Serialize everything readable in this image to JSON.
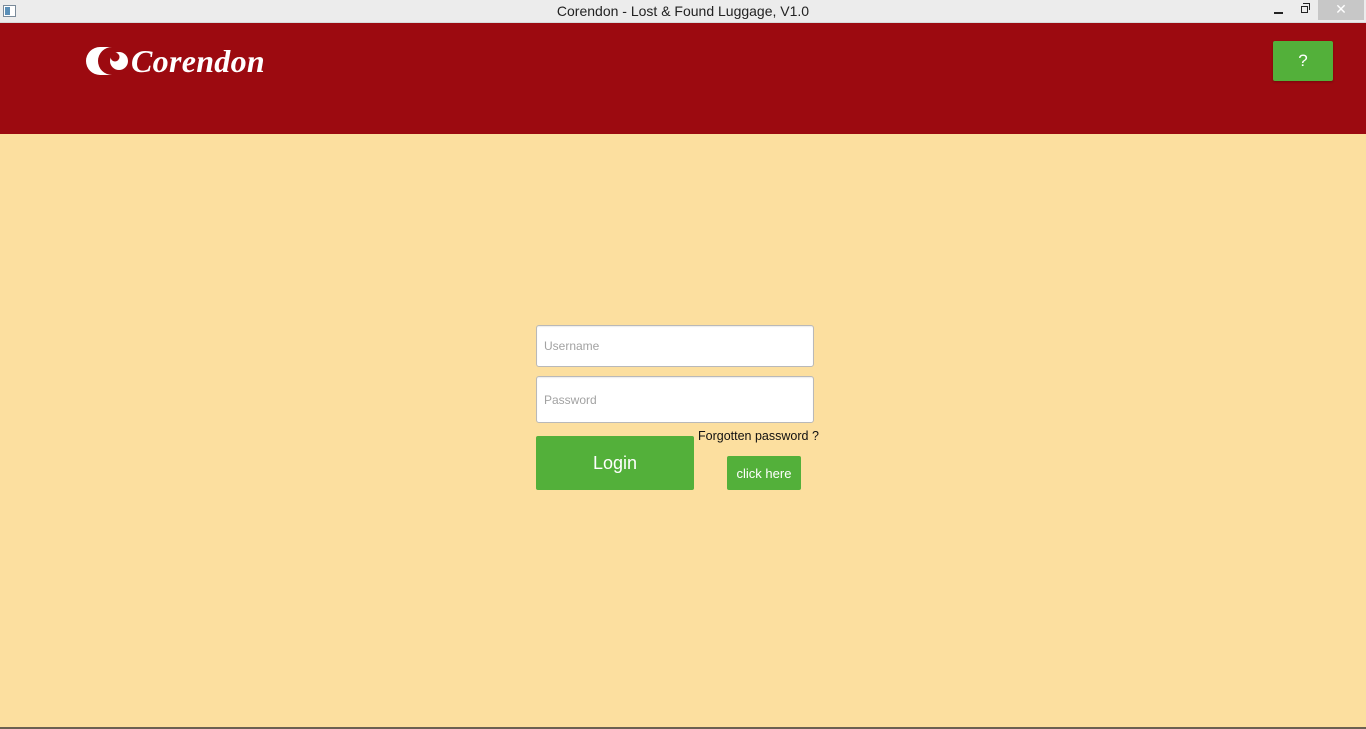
{
  "window": {
    "title": "Corendon - Lost & Found Luggage, V1.0",
    "minimize_icon": "minimize-icon",
    "maximize_icon": "restore-icon",
    "close_icon": "close-icon"
  },
  "header": {
    "brand": "Corendon",
    "logo_icon": "corendon-logo-mark",
    "help_label": "?",
    "background_color": "#9c0a10"
  },
  "login": {
    "username_placeholder": "Username",
    "username_value": "",
    "password_placeholder": "Password",
    "password_value": "",
    "login_label": "Login",
    "forgot_text": "Forgotten password ?",
    "click_here_label": "click here"
  },
  "colors": {
    "page_background": "#fcdf9f",
    "button_green": "#53b03a",
    "header_red": "#9c0a10"
  }
}
